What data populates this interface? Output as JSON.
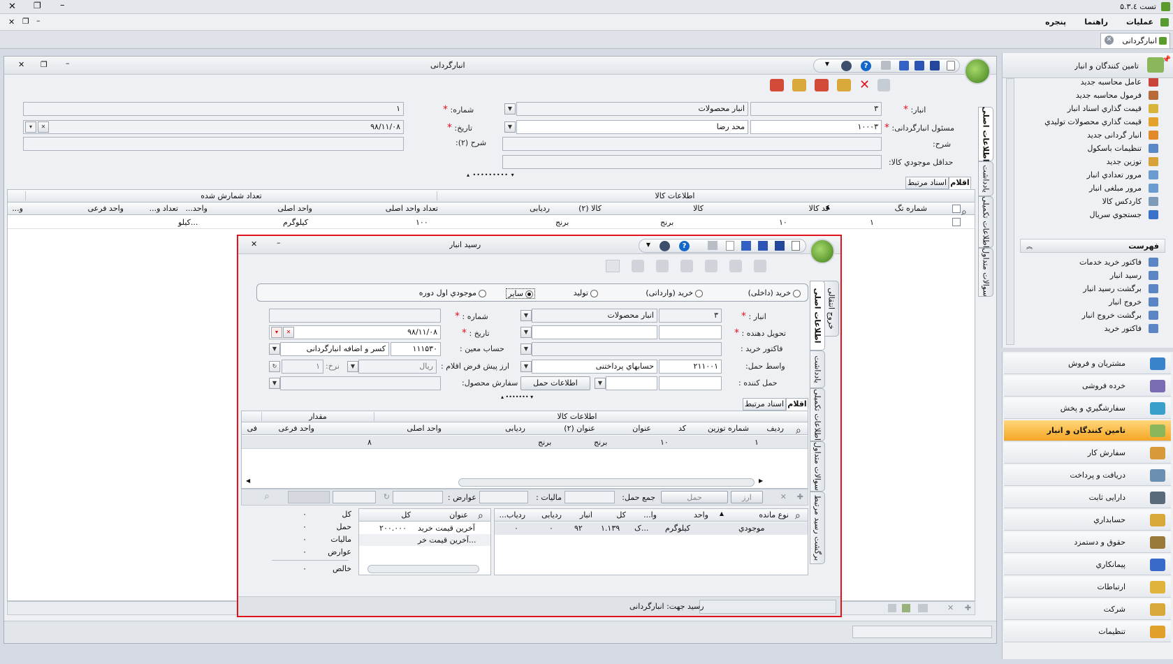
{
  "app": {
    "title": "تست ۵.۳.٤",
    "menu": [
      "عملیات",
      "راهنما",
      "پنجره"
    ],
    "doc_tab": "انبارگردانی"
  },
  "sidebar": {
    "header": "تامین کنندگان و انبار",
    "items": [
      "عامل محاسبه جدید",
      "فرمول محاسبه جدید",
      "قیمت گذاري اسناد انبار",
      "قیمت گذاري محصولات تولیدي",
      "انبار گردانی جدید",
      "تنظیمات باسکول",
      "توزین جدید",
      "مرور تعدادي انبار",
      "مرور مبلغی انبار",
      "کاردکس کالا",
      "جستجوي سریال"
    ],
    "list_header": "فهرست",
    "list_items": [
      "فاکتور خرید خدمات",
      "رسید انبار",
      "برگشت رسید انبار",
      "خروج انبار",
      "برگشت خروج انبار",
      "فاکتور خرید"
    ],
    "nav_buttons": [
      "مشتریان و فروش",
      "خرده فروشی",
      "سفارشگیري و پخش",
      "تامین کنندگان و انبار",
      "سفارش کار",
      "دریافت و پرداخت",
      "دارایی ثابت",
      "حسابداري",
      "حقوق و دستمزد",
      "پیمانکاري",
      "ارتباطات",
      "شرکت",
      "تنظیمات"
    ],
    "active_nav": "تامین کنندگان و انبار"
  },
  "main": {
    "title": "انبارگردانی",
    "labels": {
      "anbar": "انبار:",
      "shomare": "شماره:",
      "masool": "مسئول انبارگردانی:",
      "tarikh": "تاریخ:",
      "sharh": "شرح:",
      "sharh2": "شرح (۲):",
      "hadaghal": "حداقل موجودي کالا:"
    },
    "values": {
      "anbar_code": "۳",
      "anbar_name": "انبار محصولات",
      "shomare": "۱",
      "masool_code": "۱۰۰۰۳",
      "masool_name": "محد رضا",
      "tarikh": "۹۸/۱۱/۰۸"
    },
    "vtabs": [
      "اطلاعات اصلی",
      "یادداشت",
      "اطلاعات تکمیلی",
      "سوالات متداول"
    ],
    "tabs": [
      "اقلام",
      "اسناد مرتبط"
    ],
    "grid": {
      "group_headers": [
        "اطلاعات کالا",
        "تعداد شمارش شده"
      ],
      "headers": [
        "شماره تگ",
        "کد کالا",
        "کالا",
        "کالا (۲)",
        "ردیابی",
        "تعداد واحد اصلی",
        "واحد اصلی",
        "واحد...",
        "تعداد و...",
        "واحد فرعی",
        "و..."
      ],
      "row": [
        "۱",
        "۱۰",
        "برنج",
        "برنج",
        "",
        "۱۰۰",
        "کیلوگرم",
        "کیلو...",
        "",
        "",
        ""
      ]
    }
  },
  "receipt": {
    "title": "رسید انبار",
    "radios": [
      "خرید (داخلی)",
      "خرید (وارداتی)",
      "تولید",
      "سایر",
      "موجودي اول دوره"
    ],
    "selected_radio": "سایر",
    "labels": {
      "anbar": "انبار :",
      "shomare": "شماره :",
      "tahvil": "تحویل دهنده :",
      "tarikh": "تاریخ :",
      "factor": "فاکتور خرید :",
      "hesab": "حساب معین :",
      "vaset": "واسط حمل:",
      "arz": "ارز پیش فرض اقلام :",
      "nerkh": "نرخ:",
      "haml_konande": "حمل کننده :",
      "sefaresh": "سفارش محصول:"
    },
    "values": {
      "anbar_code": "۳",
      "anbar_name": "انبار محصولات",
      "tarikh": "۹۸/۱۱/۰۸",
      "hesab_code": "۱۱۱۵۳۰",
      "hesab_name": "کسر و اضافه انبارگردانی",
      "vaset_code": "۲۱۱۰۰۱",
      "vaset_name": "حسابهاي پرداختنی",
      "arz": "ریال",
      "nerkh": "۱"
    },
    "haml_button": "اطلاعات حمل",
    "vtabs": [
      "اطلاعات اصلی",
      "یادداشت",
      "اطلاعات تکمیلی",
      "سوالات متداول",
      "برگشت رسید مرتبط",
      "خروج انتقالی"
    ],
    "tabs": [
      "اقلام",
      "اسناد مرتبط"
    ],
    "grid": {
      "group_headers": [
        "اطلاعات کالا",
        "مقدار"
      ],
      "headers": [
        "ردیف",
        "شماره توزین",
        "کد",
        "عنوان",
        "عنوان (۲)",
        "ردیابی",
        "واحد اصلی",
        "واحد فرعی",
        "فی"
      ],
      "row": [
        "۱",
        "",
        "۱۰",
        "برنج",
        "برنج",
        "",
        "۸",
        "",
        ""
      ]
    },
    "footer": {
      "jame_haml": "جمع حمل:",
      "maliyat": "مالیات :",
      "avarez": "عوارض :",
      "haml": "حمل",
      "arz": "ارز"
    },
    "stock": {
      "headers": [
        "نوع مانده",
        "واحد",
        "وا...",
        "کل",
        "انبار",
        "ردیابی",
        "ردیاب..."
      ],
      "row": [
        "موجودي",
        "کیلوگرم",
        "ک...",
        "۱.۱۳۹",
        "۹۲",
        "۰",
        "۰"
      ]
    },
    "price": {
      "headers": [
        "عنوان",
        "کل"
      ],
      "rows": [
        [
          "آخرین قیمت خرید",
          "۲۰۰.۰۰۰"
        ],
        [
          "آخرین قیمت خر...",
          ""
        ]
      ]
    },
    "totals": {
      "labels": [
        "کل",
        "حمل",
        "مالیات",
        "عوارض",
        "خالص"
      ],
      "values": [
        "۰",
        "۰",
        "۰",
        "۰",
        "۰"
      ]
    },
    "status": "رسید جهت: انبارگردانی"
  }
}
